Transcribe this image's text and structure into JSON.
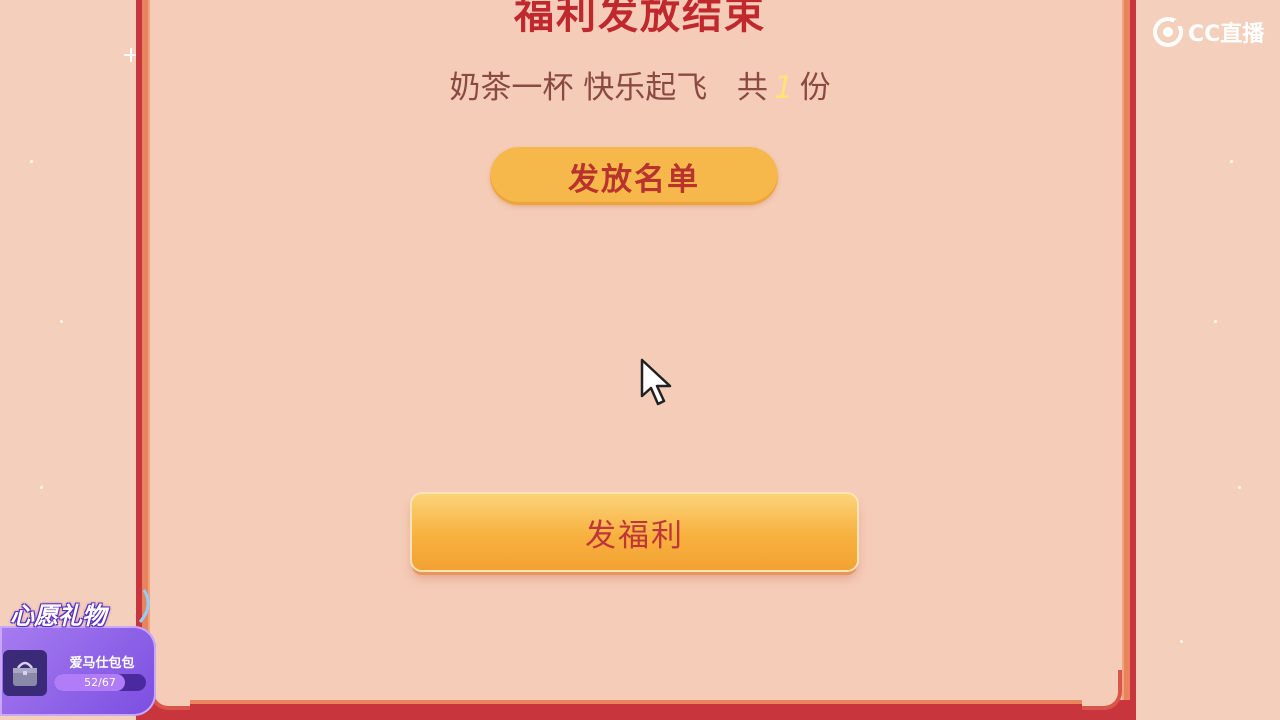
{
  "dialog": {
    "title": "福利发放结束",
    "subtitle_text": "奶茶一杯 快乐起飞",
    "subtitle_prefix": "共",
    "subtitle_count": "1",
    "subtitle_suffix": "份",
    "list_button": "发放名单",
    "action_button": "发福利"
  },
  "brand": {
    "logo_text": "CC直播"
  },
  "wish_gift": {
    "title": "心愿礼物",
    "item_name": "爱马仕包包",
    "progress_text": "52/67",
    "progress_fraction": 0.776
  },
  "colors": {
    "background": "#f4cfbb",
    "frame": "#c8353c",
    "title": "#c0282e",
    "button": "#f6b84a",
    "count_highlight": "#ffe27a",
    "wish_purple": "#7b4ee0"
  }
}
